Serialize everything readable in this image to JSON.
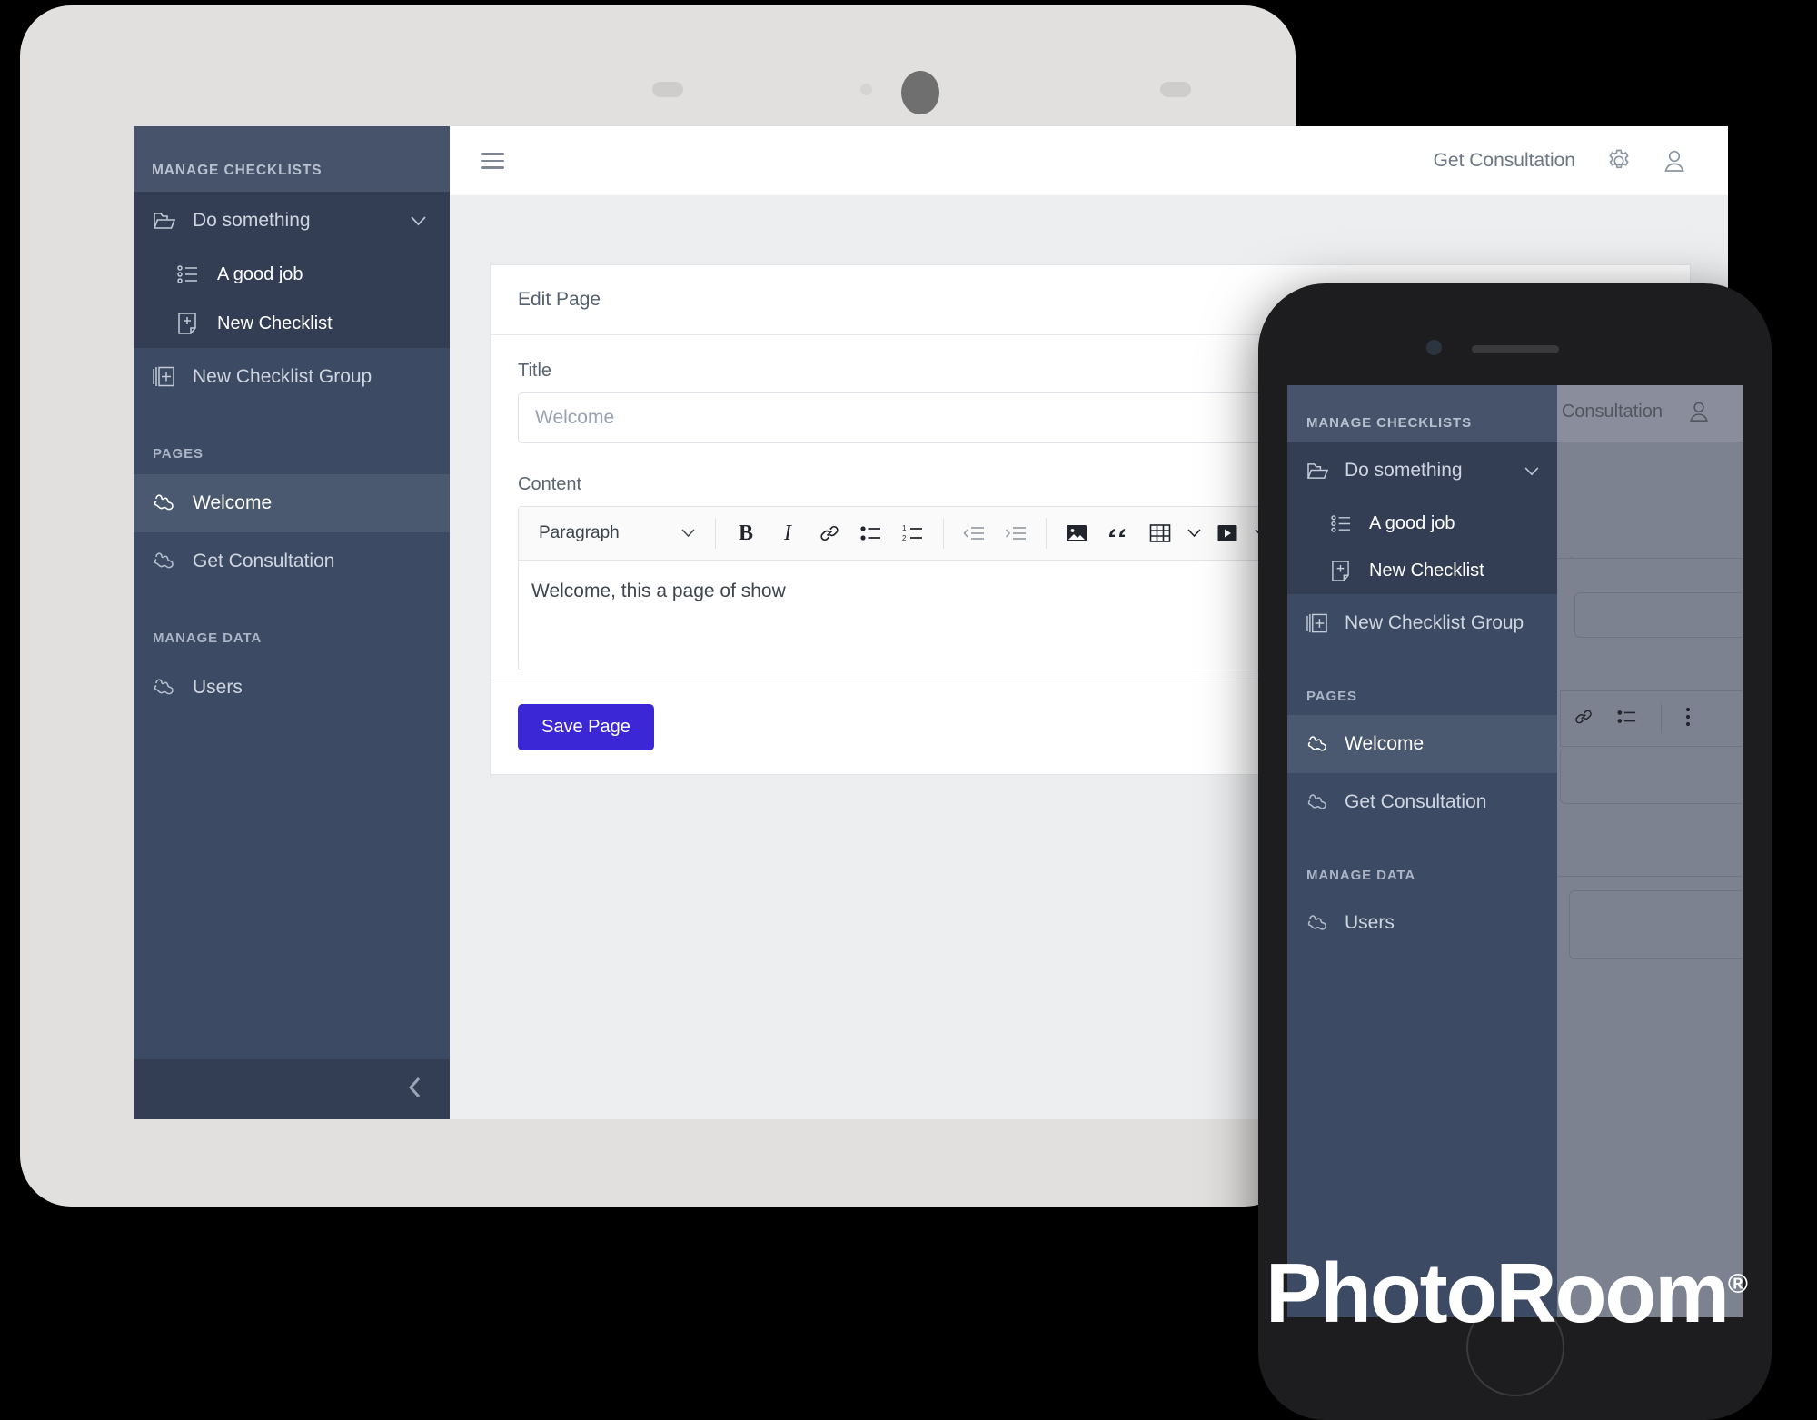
{
  "tablet": {
    "sidebar": {
      "header": "MANAGE CHECKLISTS",
      "group_item": {
        "label": "Do something",
        "icon": "folder-open-icon",
        "chevron": "chevron-down-icon"
      },
      "group_children": [
        {
          "label": "A good job",
          "icon": "checklist-icon"
        },
        {
          "label": "New Checklist",
          "icon": "new-file-icon"
        }
      ],
      "new_group": {
        "label": "New Checklist Group",
        "icon": "copy-add-icon"
      },
      "sections": [
        {
          "title": "PAGES",
          "items": [
            {
              "label": "Welcome",
              "icon": "page-icon",
              "active": true
            },
            {
              "label": "Get Consultation",
              "icon": "page-icon",
              "active": false
            }
          ]
        },
        {
          "title": "MANAGE DATA",
          "items": [
            {
              "label": "Users",
              "icon": "page-icon",
              "active": false
            }
          ]
        }
      ],
      "collapse_icon": "chevron-left-icon"
    },
    "topbar": {
      "menu_icon": "hamburger-icon",
      "link": "Get Consultation",
      "settings_icon": "gear-icon",
      "account_icon": "user-icon"
    },
    "card": {
      "heading": "Edit Page",
      "title_label": "Title",
      "title_value": "Welcome",
      "content_label": "Content",
      "editor": {
        "block_format": "Paragraph",
        "block_chevron": "chevron-down-icon",
        "tools": [
          {
            "name": "bold-icon",
            "glyph": "B"
          },
          {
            "name": "italic-icon",
            "glyph": "I"
          },
          {
            "name": "link-icon",
            "glyph": ""
          },
          {
            "name": "bullet-list-icon",
            "glyph": ""
          },
          {
            "name": "numbered-list-icon",
            "glyph": ""
          },
          {
            "name": "outdent-icon",
            "glyph": ""
          },
          {
            "name": "indent-icon",
            "glyph": ""
          },
          {
            "name": "image-icon",
            "glyph": ""
          },
          {
            "name": "blockquote-icon",
            "glyph": ""
          },
          {
            "name": "table-icon",
            "glyph": ""
          },
          {
            "name": "video-icon",
            "glyph": ""
          },
          {
            "name": "undo-icon",
            "glyph": ""
          },
          {
            "name": "redo-icon",
            "glyph": ""
          }
        ],
        "body_text": "Welcome, this a page of show"
      },
      "save_label": "Save Page",
      "save_color": "#3b27d6"
    }
  },
  "phone": {
    "overlay_link": "et Consultation",
    "account_icon": "user-icon",
    "sidebar": {
      "header": "MANAGE CHECKLISTS",
      "group_item": {
        "label": "Do something",
        "icon": "folder-open-icon",
        "chevron": "chevron-down-icon"
      },
      "group_children": [
        {
          "label": "A good job",
          "icon": "checklist-icon"
        },
        {
          "label": "New Checklist",
          "icon": "new-file-icon"
        }
      ],
      "new_group": {
        "label": "New Checklist Group",
        "icon": "copy-add-icon"
      },
      "sections": [
        {
          "title": "PAGES",
          "items": [
            {
              "label": "Welcome",
              "icon": "page-icon",
              "active": true
            },
            {
              "label": "Get Consultation",
              "icon": "page-icon",
              "active": false
            }
          ]
        },
        {
          "title": "MANAGE DATA",
          "items": [
            {
              "label": "Users",
              "icon": "page-icon",
              "active": false
            }
          ]
        }
      ]
    },
    "toolbar_icons": [
      "link-icon",
      "bullet-list-icon",
      "more-vertical-icon"
    ]
  },
  "watermark": {
    "text": "PhotoRoom",
    "mark": "®"
  },
  "colors": {
    "sidebar_bg": "#3c4a63",
    "sidebar_header_bg": "#46536b",
    "sidebar_group_bg": "#333e55",
    "sidebar_active_bg": "#4a5870",
    "accent": "#3b27d6",
    "content_bg": "#eceeef",
    "device_body": "#e2e0de",
    "phone_body": "#1d1d1f"
  }
}
